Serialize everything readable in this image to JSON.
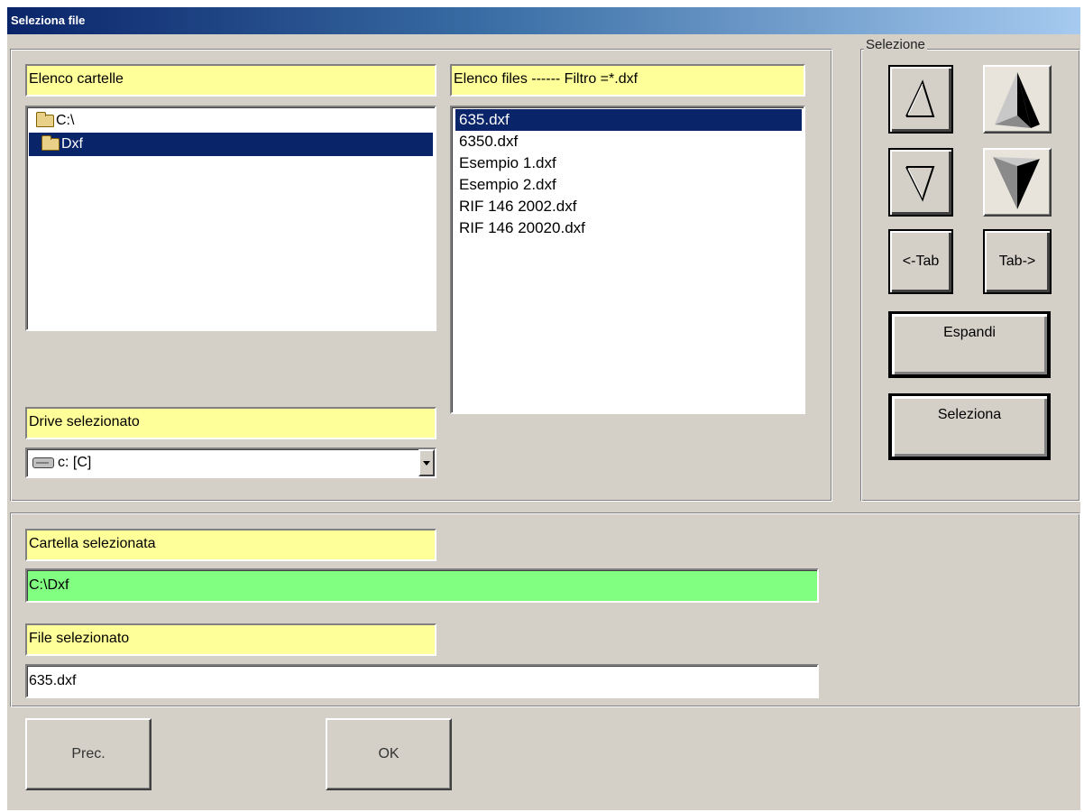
{
  "window": {
    "title": "Seleziona file"
  },
  "folders": {
    "header": "Elenco cartelle",
    "items": [
      {
        "label": "C:\\",
        "selected": false
      },
      {
        "label": "Dxf",
        "selected": true
      }
    ]
  },
  "files": {
    "header": "Elenco files ------ Filtro =*.dxf",
    "items": [
      {
        "label": "635.dxf",
        "selected": true
      },
      {
        "label": "6350.dxf",
        "selected": false
      },
      {
        "label": "Esempio 1.dxf",
        "selected": false
      },
      {
        "label": "Esempio 2.dxf",
        "selected": false
      },
      {
        "label": "RIF 146 2002.dxf",
        "selected": false
      },
      {
        "label": "RIF 146 20020.dxf",
        "selected": false
      }
    ]
  },
  "drive": {
    "header": "Drive selezionato",
    "value": "c: [C]"
  },
  "selection_panel": {
    "legend": "Selezione",
    "tab_prev_label": "<-Tab",
    "tab_next_label": "Tab->",
    "expand_label": "Espandi",
    "select_label": "Seleziona"
  },
  "selected_folder": {
    "header": "Cartella selezionata",
    "value": "C:\\Dxf"
  },
  "selected_file": {
    "header": "File selezionato",
    "value": "635.dxf"
  },
  "footer": {
    "prev_label": "Prec.",
    "ok_label": "OK"
  },
  "colors": {
    "label_bg": "#ffff99",
    "folder_field_bg": "#80ff80",
    "selection_bg": "#0a246a",
    "window_bg": "#d4d0c8"
  }
}
